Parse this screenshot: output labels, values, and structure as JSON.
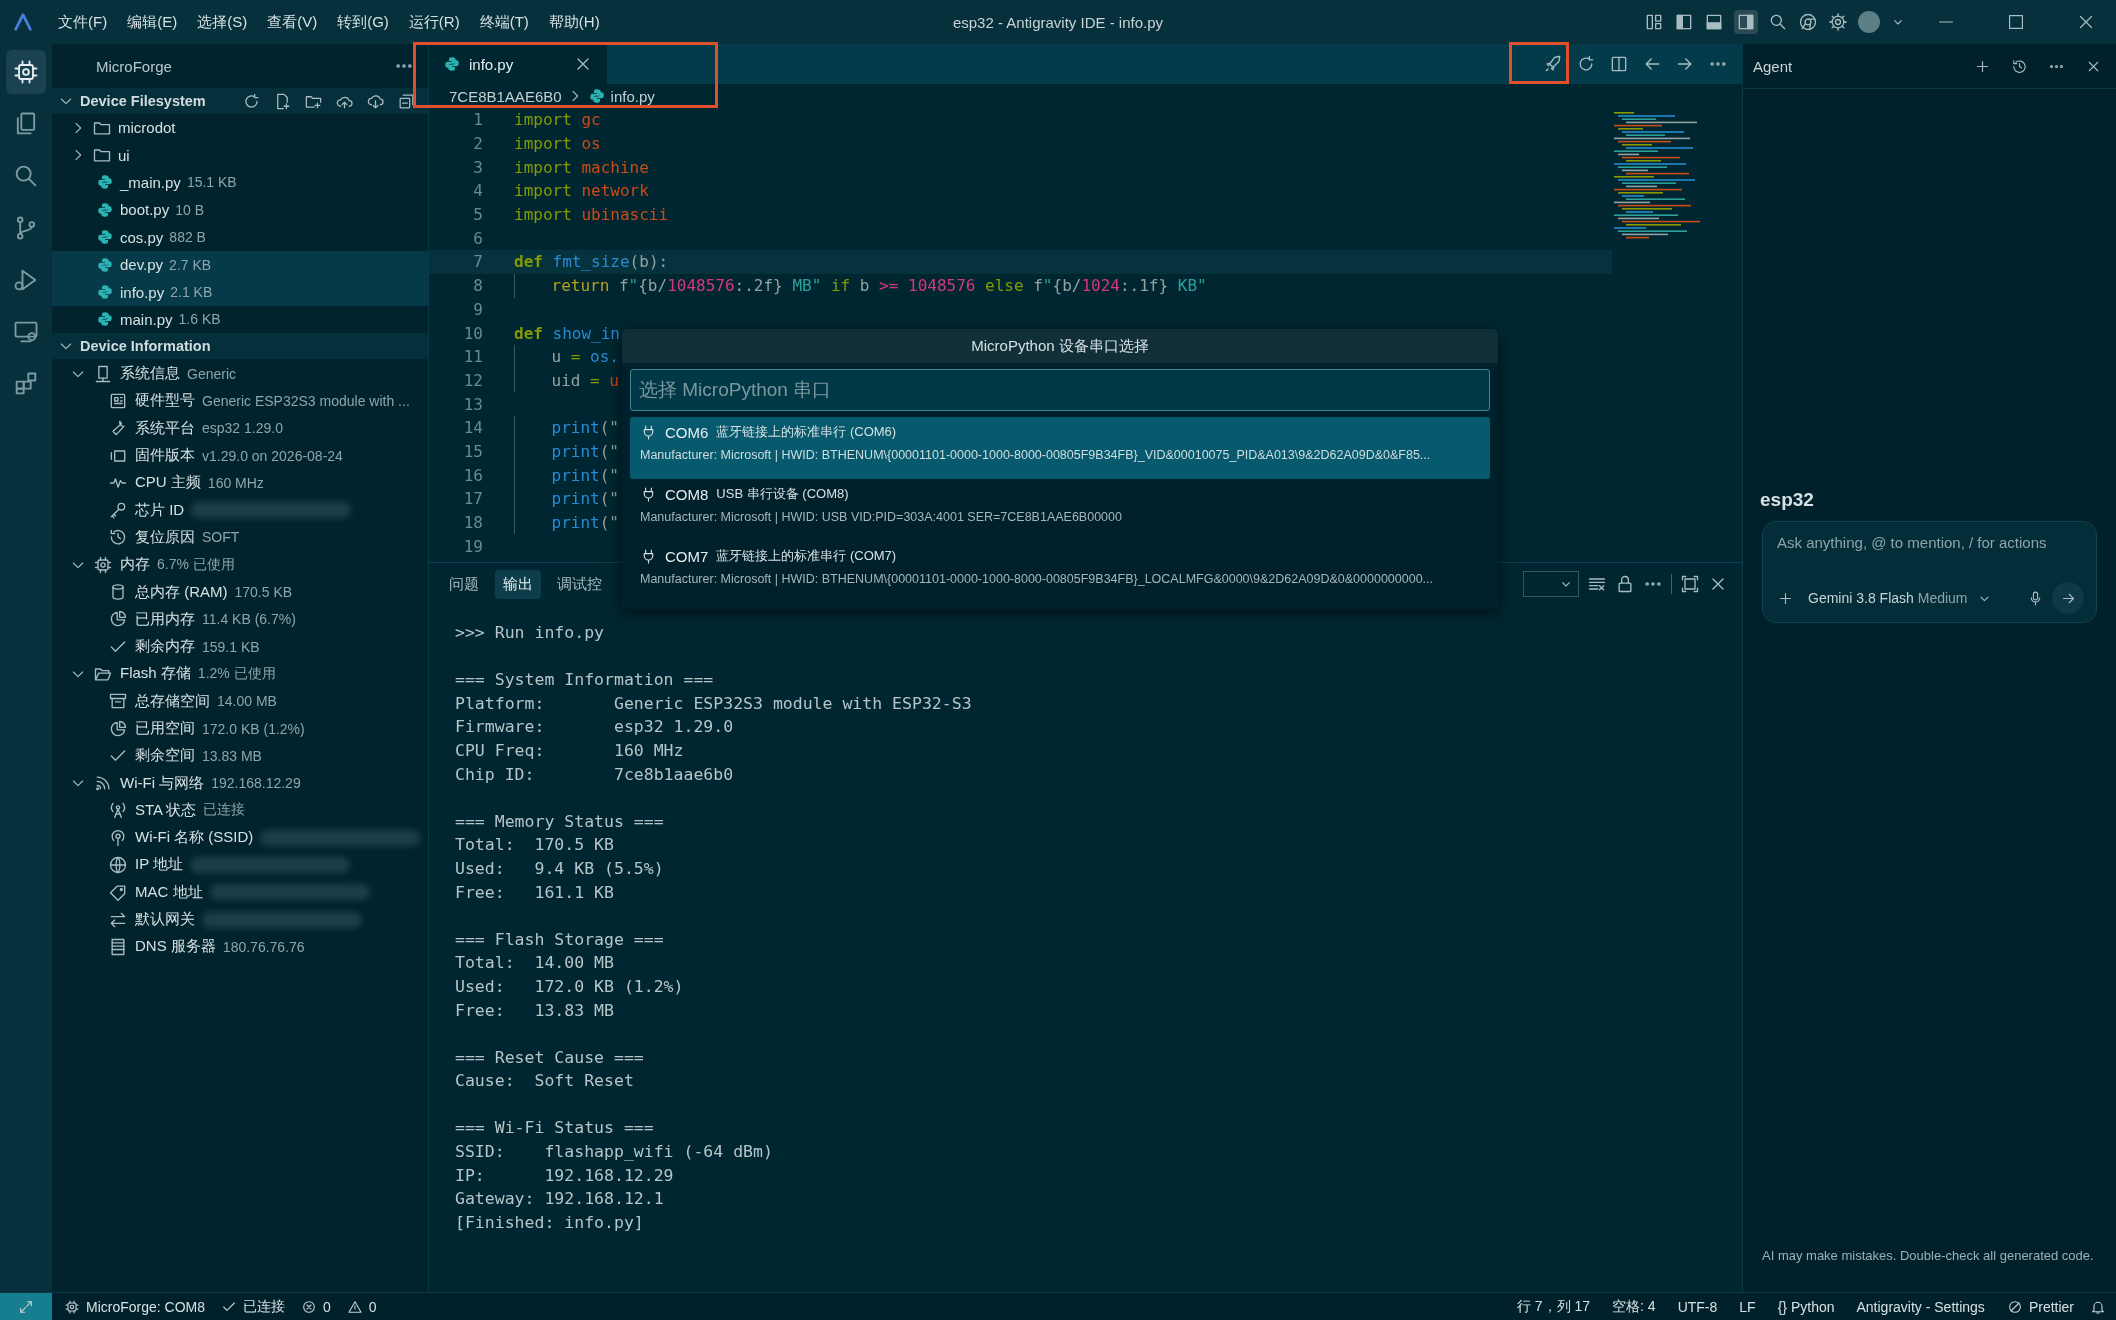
{
  "window": {
    "title": "esp32 - Antigravity IDE - info.py",
    "menus": [
      "文件(F)",
      "编辑(E)",
      "选择(S)",
      "查看(V)",
      "转到(G)",
      "运行(R)",
      "终端(T)",
      "帮助(H)"
    ]
  },
  "activity_bar": [
    {
      "selected": true
    },
    {
      "selected": false
    },
    {
      "selected": false
    },
    {
      "selected": false
    },
    {
      "selected": false
    },
    {
      "selected": false
    },
    {
      "selected": false
    }
  ],
  "sidebar": {
    "title": "MicroForge",
    "filesystem": {
      "title": "Device Filesystem",
      "expanded": true,
      "items": [
        {
          "kind": "folder",
          "name": "microdot",
          "expanded": false,
          "selected": false
        },
        {
          "kind": "folder",
          "name": "ui",
          "expanded": false,
          "selected": false
        },
        {
          "kind": "file",
          "name": "_main.py",
          "size": "15.1 KB",
          "selected": false
        },
        {
          "kind": "file",
          "name": "boot.py",
          "size": "10 B",
          "selected": false
        },
        {
          "kind": "file",
          "name": "cos.py",
          "size": "882 B",
          "selected": false
        },
        {
          "kind": "file",
          "name": "dev.py",
          "size": "2.7 KB",
          "selected": true
        },
        {
          "kind": "file",
          "name": "info.py",
          "size": "2.1 KB",
          "selected": true
        },
        {
          "kind": "file",
          "name": "main.py",
          "size": "1.6 KB",
          "selected": false
        }
      ]
    },
    "device_info": {
      "title": "Device Information",
      "expanded": true,
      "groups": [
        {
          "label": "系统信息",
          "value": "Generic",
          "expanded": true,
          "children": [
            {
              "label": "硬件型号",
              "value": "Generic ESP32S3 module with ...",
              "redacted": false
            },
            {
              "label": "系统平台",
              "value": "esp32 1.29.0",
              "redacted": false
            },
            {
              "label": "固件版本",
              "value": "v1.29.0 on 2026-08-24",
              "redacted": false
            },
            {
              "label": "CPU 主频",
              "value": "160 MHz",
              "redacted": false
            },
            {
              "label": "芯片 ID",
              "redacted": true
            },
            {
              "label": "复位原因",
              "value": "SOFT",
              "redacted": false
            }
          ]
        },
        {
          "label": "内存",
          "value": "6.7% 已使用",
          "expanded": true,
          "children": [
            {
              "label": "总内存 (RAM)",
              "value": "170.5 KB",
              "redacted": false
            },
            {
              "label": "已用内存",
              "value": "11.4 KB (6.7%)",
              "redacted": false
            },
            {
              "label": "剩余内存",
              "value": "159.1 KB",
              "redacted": false
            }
          ]
        },
        {
          "label": "Flash 存储",
          "value": "1.2% 已使用",
          "expanded": true,
          "children": [
            {
              "label": "总存储空间",
              "value": "14.00 MB",
              "redacted": false
            },
            {
              "label": "已用空间",
              "value": "172.0 KB (1.2%)",
              "redacted": false
            },
            {
              "label": "剩余空间",
              "value": "13.83 MB",
              "redacted": false
            }
          ]
        },
        {
          "label": "Wi-Fi 与网络",
          "value": "192.168.12.29",
          "expanded": true,
          "children": [
            {
              "label": "STA 状态",
              "value": "已连接",
              "redacted": false
            },
            {
              "label": "Wi-Fi 名称 (SSID)",
              "redacted": true
            },
            {
              "label": "IP 地址",
              "redacted": true
            },
            {
              "label": "MAC 地址",
              "redacted": true
            },
            {
              "label": "默认网关",
              "redacted": true
            },
            {
              "label": "DNS 服务器",
              "value": "180.76.76.76",
              "redacted": false
            }
          ]
        }
      ]
    }
  },
  "editor": {
    "tab": {
      "label": "info.py",
      "selected": true
    },
    "breadcrumb": [
      "7CE8B1AAE6B0",
      "info.py"
    ],
    "highlights": {
      "tab_and_breadcrumb": true,
      "run_button": true
    },
    "lines": [
      {
        "n": "1",
        "current": false,
        "indent": false,
        "tokens": [
          {
            "text": "import",
            "kind": "kw"
          },
          {
            "text": " gc",
            "kind": "mod"
          }
        ]
      },
      {
        "n": "2",
        "current": false,
        "indent": false,
        "tokens": [
          {
            "text": "import",
            "kind": "kw"
          },
          {
            "text": " os",
            "kind": "mod"
          }
        ]
      },
      {
        "n": "3",
        "current": false,
        "indent": false,
        "tokens": [
          {
            "text": "import",
            "kind": "kw"
          },
          {
            "text": " machine",
            "kind": "mod"
          }
        ]
      },
      {
        "n": "4",
        "current": false,
        "indent": false,
        "tokens": [
          {
            "text": "import",
            "kind": "kw"
          },
          {
            "text": " network",
            "kind": "mod"
          }
        ]
      },
      {
        "n": "5",
        "current": false,
        "indent": false,
        "tokens": [
          {
            "text": "import",
            "kind": "kw"
          },
          {
            "text": " ubinascii",
            "kind": "mod"
          }
        ]
      },
      {
        "n": "6",
        "current": false
      },
      {
        "n": "7",
        "current": true,
        "indent": false,
        "tokens": [
          {
            "text": "def",
            "kind": "def"
          },
          {
            "text": " fmt_size",
            "kind": "fn"
          },
          {
            "text": "(b):",
            "kind": "plain"
          }
        ]
      },
      {
        "n": "8",
        "current": false,
        "indent": true,
        "tokens": [
          {
            "text": "return",
            "kind": "ret"
          },
          {
            "text": " f",
            "kind": "plain"
          },
          {
            "text": "\"",
            "kind": "str"
          },
          {
            "text": "{b/",
            "kind": "plain"
          },
          {
            "text": "1048576",
            "kind": "num"
          },
          {
            "text": ":.2f}",
            "kind": "plain"
          },
          {
            "text": " MB\"",
            "kind": "str"
          },
          {
            "text": " if",
            "kind": "kw"
          },
          {
            "text": " b ",
            "kind": "plain"
          },
          {
            "text": ">=",
            "kind": "num"
          },
          {
            "text": " 1048576",
            "kind": "num"
          },
          {
            "text": " else",
            "kind": "kw"
          },
          {
            "text": " f",
            "kind": "plain"
          },
          {
            "text": "\"",
            "kind": "str"
          },
          {
            "text": "{b/",
            "kind": "plain"
          },
          {
            "text": "1024",
            "kind": "num"
          },
          {
            "text": ":.1f}",
            "kind": "plain"
          },
          {
            "text": " KB\"",
            "kind": "str"
          }
        ]
      },
      {
        "n": "9",
        "current": false
      },
      {
        "n": "10",
        "current": false,
        "indent": false,
        "tokens": [
          {
            "text": "def",
            "kind": "def"
          },
          {
            "text": " show_in",
            "kind": "fn"
          }
        ]
      },
      {
        "n": "11",
        "current": false,
        "indent": true,
        "tokens": [
          {
            "text": "u ",
            "kind": "plain"
          },
          {
            "text": "=",
            "kind": "kw"
          },
          {
            "text": " os.",
            "kind": "fn"
          }
        ]
      },
      {
        "n": "12",
        "current": false,
        "indent": true,
        "tokens": [
          {
            "text": "uid ",
            "kind": "plain"
          },
          {
            "text": "=",
            "kind": "kw"
          },
          {
            "text": " u",
            "kind": "mod"
          }
        ]
      },
      {
        "n": "13",
        "current": false
      },
      {
        "n": "14",
        "current": false,
        "indent": true,
        "tokens": [
          {
            "text": "print",
            "kind": "fn"
          },
          {
            "text": "(\"",
            "kind": "plain"
          }
        ]
      },
      {
        "n": "15",
        "current": false,
        "indent": true,
        "tokens": [
          {
            "text": "print",
            "kind": "fn"
          },
          {
            "text": "(\"",
            "kind": "plain"
          }
        ]
      },
      {
        "n": "16",
        "current": false,
        "indent": true,
        "tokens": [
          {
            "text": "print",
            "kind": "fn"
          },
          {
            "text": "(\"",
            "kind": "plain"
          }
        ]
      },
      {
        "n": "17",
        "current": false,
        "indent": true,
        "tokens": [
          {
            "text": "print",
            "kind": "fn"
          },
          {
            "text": "(\"",
            "kind": "plain"
          }
        ]
      },
      {
        "n": "18",
        "current": false,
        "indent": true,
        "tokens": [
          {
            "text": "print",
            "kind": "fn"
          },
          {
            "text": "(\"",
            "kind": "plain"
          }
        ]
      },
      {
        "n": "19",
        "current": false
      }
    ]
  },
  "port_picker": {
    "title": "MicroPython 设备串口选择",
    "placeholder": "选择 MicroPython 串口",
    "options": [
      {
        "port": "COM6",
        "description": "蓝牙链接上的标准串行 (COM6)",
        "detail": "Manufacturer: Microsoft | HWID: BTHENUM\\{00001101-0000-1000-8000-00805F9B34FB}_VID&00010075_PID&A013\\9&2D62A09D&0&F85...",
        "selected": true
      },
      {
        "port": "COM8",
        "description": "USB 串行设备 (COM8)",
        "detail": "Manufacturer: Microsoft | HWID: USB VID:PID=303A:4001 SER=7CE8B1AAE6B00000",
        "selected": false
      },
      {
        "port": "COM7",
        "description": "蓝牙链接上的标准串行 (COM7)",
        "detail": "Manufacturer: Microsoft | HWID: BTHENUM\\{00001101-0000-1000-8000-00805F9B34FB}_LOCALMFG&0000\\9&2D62A09D&0&0000000000...",
        "selected": false
      }
    ]
  },
  "panel": {
    "tabs": [
      {
        "label": "问题",
        "selected": false
      },
      {
        "label": "输出",
        "selected": true
      },
      {
        "label": "调试控",
        "selected": false
      }
    ],
    "output": [
      [
        ">>> Run info.py"
      ],
      [
        "=== System Information ===",
        "Platform:       Generic ESP32S3 module with ESP32-S3",
        "Firmware:       esp32 1.29.0",
        "CPU Freq:       160 MHz",
        "Chip ID:        7ce8b1aae6b0"
      ],
      [
        "=== Memory Status ===",
        "Total:  170.5 KB",
        "Used:   9.4 KB (5.5%)",
        "Free:   161.1 KB"
      ],
      [
        "=== Flash Storage ===",
        "Total:  14.00 MB",
        "Used:   172.0 KB (1.2%)",
        "Free:   13.83 MB"
      ],
      [
        "=== Reset Cause ===",
        "Cause:  Soft Reset"
      ],
      [
        "=== Wi-Fi Status ===",
        "SSID:    flashapp_wifi (-64 dBm)",
        "IP:      192.168.12.29",
        "Gateway: 192.168.12.1",
        "[Finished: info.py]"
      ]
    ]
  },
  "agent": {
    "title": "Agent",
    "workspace": "esp32",
    "placeholder": "Ask anything, @ to mention, / for actions",
    "model": "Gemini 3.8 Flash",
    "model_tier": "Medium",
    "disclaimer": "AI may make mistakes. Double-check all generated code."
  },
  "status_bar": {
    "device": "MicroForge: COM8",
    "connection": "已连接",
    "errors": "0",
    "warnings": "0",
    "right": [
      "行 7，列 17",
      "空格: 4",
      "UTF-8",
      "LF",
      "{} Python",
      "Antigravity - Settings"
    ],
    "formatter": "Prettier"
  }
}
